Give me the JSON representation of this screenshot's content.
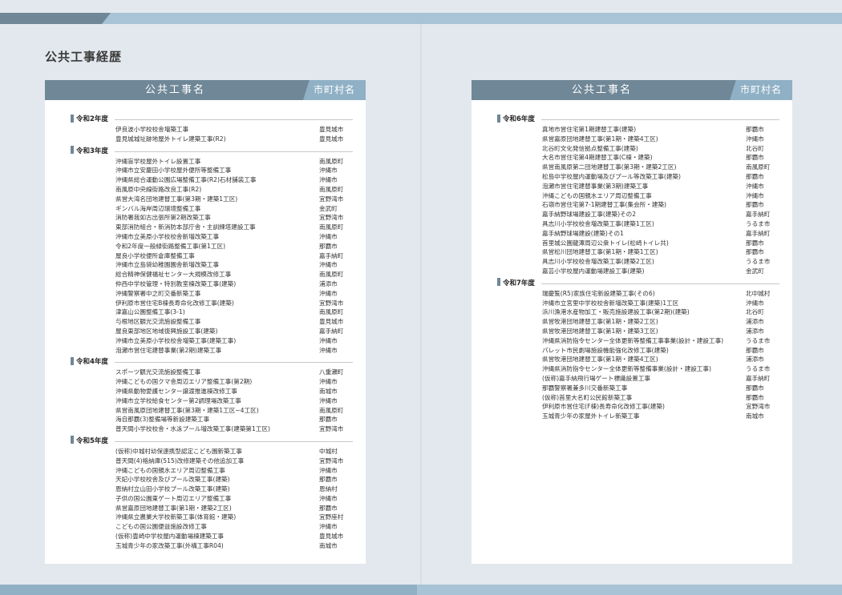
{
  "page": {
    "title": "公共工事経歴"
  },
  "table_header": {
    "project_col": "公共工事名",
    "city_col": "市町村名"
  },
  "left_column": [
    {
      "year": "令和2年度",
      "items": [
        {
          "name": "伊良波小学校校舎増築工事",
          "city": "豊見城市"
        },
        {
          "name": "豊見城城址跡地屋外トイレ建築工事(R2)",
          "city": "豊見城市"
        }
      ]
    },
    {
      "year": "令和3年度",
      "items": [
        {
          "name": "沖縄盲学校屋外トイレ設置工事",
          "city": "南風原町"
        },
        {
          "name": "沖縄市立安慶田小学校屋外便所等整備工事",
          "city": "沖縄市"
        },
        {
          "name": "沖縄県総合運動公園広場整備工事(R2)石材舗装工事",
          "city": "沖縄市"
        },
        {
          "name": "南風原中央線街路改良工事(R2)",
          "city": "南風原町"
        },
        {
          "name": "県営大湾名団地建替工事(第3期・建築1工区)",
          "city": "宜野湾市"
        },
        {
          "name": "ギンバル海岸周辺環境整備工事",
          "city": "金武町"
        },
        {
          "name": "消防署我如古出張所第2期改築工事",
          "city": "宜野湾市"
        },
        {
          "name": "東部消防組合・新消防本部庁舎・主訓練塔建設工事",
          "city": "南風原町"
        },
        {
          "name": "沖縄市立美原小学校校舎新増改築工事",
          "city": "沖縄市"
        },
        {
          "name": "令和2年度一般緑街路整備工事(第1工区)",
          "city": "那覇市"
        },
        {
          "name": "屋良小学校便所倉庫整備工事",
          "city": "嘉手納町"
        },
        {
          "name": "沖縄市立島袋幼稚園園舎新増改築工事",
          "city": "沖縄市"
        },
        {
          "name": "総合精神保健福祉センター大規模改修工事",
          "city": "南風原町"
        },
        {
          "name": "仲西中学校管理・特別教室棟改築工事(建築)",
          "city": "浦添市"
        },
        {
          "name": "沖縄警察署中之町交番新築工事",
          "city": "沖縄市"
        },
        {
          "name": "伊利原市営住宅B棟長寿命化改修工事(建築)",
          "city": "宜野湾市"
        },
        {
          "name": "津嘉山公園整備工事(3-1)",
          "city": "南風原町"
        },
        {
          "name": "与根地区観光交流施設整備工事",
          "city": "豊見城市"
        },
        {
          "name": "屋良東部地区地域復興施設工事(建築)",
          "city": "嘉手納町"
        },
        {
          "name": "沖縄市立美原小学校校舎増築工事(建築工事)",
          "city": "沖縄市"
        },
        {
          "name": "泡瀬市営住宅建替事業(第2期)建築工事",
          "city": "沖縄市"
        }
      ]
    },
    {
      "year": "令和4年度",
      "items": [
        {
          "name": "スポーツ観光交流施設整備工事",
          "city": "八重瀬町"
        },
        {
          "name": "沖縄こどもの国クマ舎周辺エリア整備工事(第2期)",
          "city": "沖縄市"
        },
        {
          "name": "沖縄県動物愛護センター譲渡推進棟改修工事",
          "city": "南城市"
        },
        {
          "name": "沖縄市立学校給食センター第2調理場改築工事",
          "city": "沖縄市"
        },
        {
          "name": "県営南風原団地建替工事(第3期・建築1工区~4工区)",
          "city": "南風原町"
        },
        {
          "name": "海自那覇(3)整備場等新設建築工事",
          "city": "那覇市"
        },
        {
          "name": "普天間小学校校舎・水泳プール増改築工事(建築第1工区)",
          "city": "宜野湾市"
        }
      ]
    },
    {
      "year": "令和5年度",
      "items": [
        {
          "name": "(仮称)中城村幼保連携型認定こども園新築工事",
          "city": "中城村"
        },
        {
          "name": "普天間(4)格納庫(515)改修建築その他追加工事",
          "city": "宜野湾市"
        },
        {
          "name": "沖縄こどもの国親水エリア周辺整備工事",
          "city": "沖縄市"
        },
        {
          "name": "天妃小学校校舎及びプール改築工事(建築)",
          "city": "那覇市"
        },
        {
          "name": "恩納村立山田小学校プール改築工事(建築)",
          "city": "恩納村"
        },
        {
          "name": "子供の国公園東ゲート周辺エリア整備工事",
          "city": "沖縄市"
        },
        {
          "name": "県営嘉原団地建替工事(第1期・建築2工区)",
          "city": "那覇市"
        },
        {
          "name": "沖縄県立農業大学校新築工事(体育館・建築)",
          "city": "宜野座村"
        },
        {
          "name": "こどもの国公園便益施設改修工事",
          "city": "沖縄市"
        },
        {
          "name": "(仮称)豊崎中学校屋内運動場棟建築工事",
          "city": "豊見城市"
        },
        {
          "name": "玉城青少年の家改築工事(外構工事R04)",
          "city": "南城市"
        }
      ]
    }
  ],
  "right_column": [
    {
      "year": "令和6年度",
      "items": [
        {
          "name": "真地市営住宅第1期建替工事(建築)",
          "city": "那覇市"
        },
        {
          "name": "県営嘉原団地建替工事(第1期・建築4工区)",
          "city": "沖縄市"
        },
        {
          "name": "北谷町文化発信拠点整備工事(建築)",
          "city": "北谷町"
        },
        {
          "name": "大名市営住宅第4期建替工事(C棟・建築)",
          "city": "那覇市"
        },
        {
          "name": "県営南風原第二団地建替工事(第3期・建築2工区)",
          "city": "南風原町"
        },
        {
          "name": "松島中学校屋内運動場及びプール等改築工事(建築)",
          "city": "那覇市"
        },
        {
          "name": "泡瀬市営住宅建替事業(第3期)建築工事",
          "city": "沖縄市"
        },
        {
          "name": "沖縄こどもの国親水エリア周辺整備工事",
          "city": "沖縄市"
        },
        {
          "name": "石嶺市営住宅第7-1期建替工事(集会所・建築)",
          "city": "那覇市"
        },
        {
          "name": "嘉手納野球場建設工事(建築)その2",
          "city": "嘉手納町"
        },
        {
          "name": "具志川小学校校舎増改築工事(建築1工区)",
          "city": "うるま市"
        },
        {
          "name": "嘉手納野球場建設(建築)その1",
          "city": "嘉手納町"
        },
        {
          "name": "首里城公園龍潭周辺公衆トイレ(松崎トイレ共)",
          "city": "那覇市"
        },
        {
          "name": "県営松川団地建替工事(第1期・建築1工区)",
          "city": "那覇市"
        },
        {
          "name": "具志川小学校校舎増改築工事(建築2工区)",
          "city": "うるま市"
        },
        {
          "name": "嘉芸小学校屋内運動場建設工事(建築)",
          "city": "金武町"
        }
      ]
    },
    {
      "year": "令和7年度",
      "items": [
        {
          "name": "瑞慶覧(R5)家族住宅新設建築工事(その6)",
          "city": "北中城村"
        },
        {
          "name": "沖縄市立宮里中学校校舎新増改築工事(建築)1工区",
          "city": "沖縄市"
        },
        {
          "name": "浜川漁港水産物加工・販売施設建設工事(第2期)(建築)",
          "city": "北谷町"
        },
        {
          "name": "県営牧港団地建替工事(第1期・建築2工区)",
          "city": "浦添市"
        },
        {
          "name": "県営牧港団地建替工事(第1期・建築3工区)",
          "city": "浦添市"
        },
        {
          "name": "沖縄県消防指令センター全体更新等整備工事事業(設計・建設工事)",
          "city": "うるま市"
        },
        {
          "name": "パレット市民劇場施設機能強化改修工事(建築)",
          "city": "那覇市"
        },
        {
          "name": "県営牧港団地建替工事(第1期・建築4工区)",
          "city": "浦添市"
        },
        {
          "name": "沖縄県消防指令センター全体更新等整備事業(設計・建設工事)",
          "city": "うるま市"
        },
        {
          "name": "(仮称)嘉手納飛行場ゲート標識設置工事",
          "city": "嘉手納町"
        },
        {
          "name": "那覇警察署兼多川交番新築工事",
          "city": "那覇市"
        },
        {
          "name": "(仮称)首里大名町公民館新築工事",
          "city": "那覇市"
        },
        {
          "name": "伊利原市営住宅(F棟)長寿命化改修工事(建築)",
          "city": "宜野湾市"
        },
        {
          "name": "玉城青少年の家屋外トイレ新築工事",
          "city": "南城市"
        }
      ]
    }
  ]
}
